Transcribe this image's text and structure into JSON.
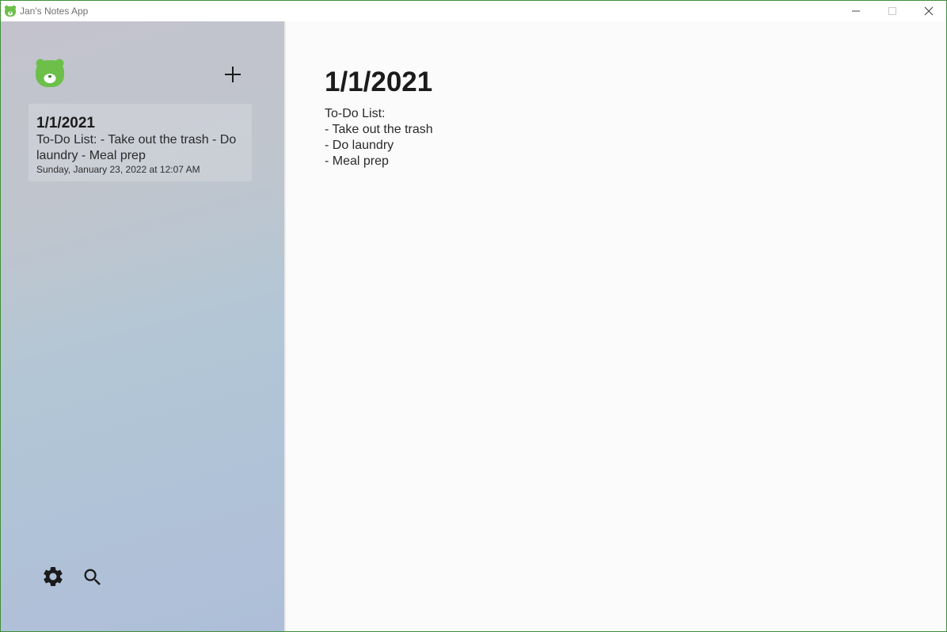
{
  "window": {
    "title": "Jan's Notes App",
    "accent": "#3f8f3a",
    "brand_green": "#6cc04a"
  },
  "sidebar": {
    "logo_icon": "bear-logo-icon",
    "add_icon": "plus-icon",
    "notes": [
      {
        "title": "1/1/2021",
        "preview": "To-Do List: - Take out the trash - Do laundry - Meal prep",
        "date": "Sunday, January 23, 2022 at 12:07 AM"
      }
    ],
    "footer": {
      "settings_icon": "gear-icon",
      "search_icon": "search-icon"
    }
  },
  "editor": {
    "title": "1/1/2021",
    "lines": [
      "To-Do List:",
      "- Take out the trash",
      "- Do laundry",
      "- Meal prep"
    ]
  }
}
